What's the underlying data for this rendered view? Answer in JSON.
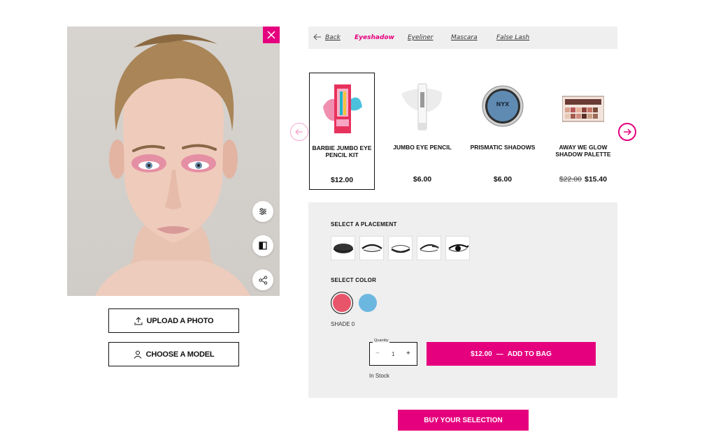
{
  "photo": {
    "alt": "model-face"
  },
  "tools": {
    "close": "close-icon",
    "adjust": "sliders-icon",
    "compare": "compare-icon",
    "share": "share-icon"
  },
  "upload_label": "UPLOAD A PHOTO",
  "choose_model_label": "CHOOSE A MODEL",
  "tabs": {
    "back": "Back",
    "items": [
      "Eyeshadow",
      "Eyeliner",
      "Mascara",
      "False Lash"
    ],
    "active": "Eyeshadow"
  },
  "products": [
    {
      "name": "BARBIE JUMBO EYE PENCIL KIT",
      "price": "$12.00",
      "old_price": "",
      "selected": true
    },
    {
      "name": "JUMBO EYE PENCIL",
      "price": "$6.00",
      "old_price": ""
    },
    {
      "name": "PRISMATIC SHADOWS",
      "price": "$6.00",
      "old_price": ""
    },
    {
      "name": "AWAY WE GLOW SHADOW PALETTE",
      "price": "$15.40",
      "old_price": "$22.00"
    }
  ],
  "options": {
    "placement_title": "SELECT A PLACEMENT",
    "color_title": "SELECT COLOR",
    "swatches": [
      "#e8546a",
      "#6cb7e0"
    ],
    "shade_label": "SHADE 0",
    "quantity_label": "Quantity",
    "quantity_minus": "−",
    "quantity_plus": "+",
    "quantity": "1",
    "add_price": "$12.00",
    "add_separator": "—",
    "add_label": "ADD TO BAG",
    "stock": "In Stock"
  },
  "buy_label": "BUY YOUR SELECTION",
  "colors": {
    "accent": "#e5007e",
    "panel": "#efefef"
  }
}
